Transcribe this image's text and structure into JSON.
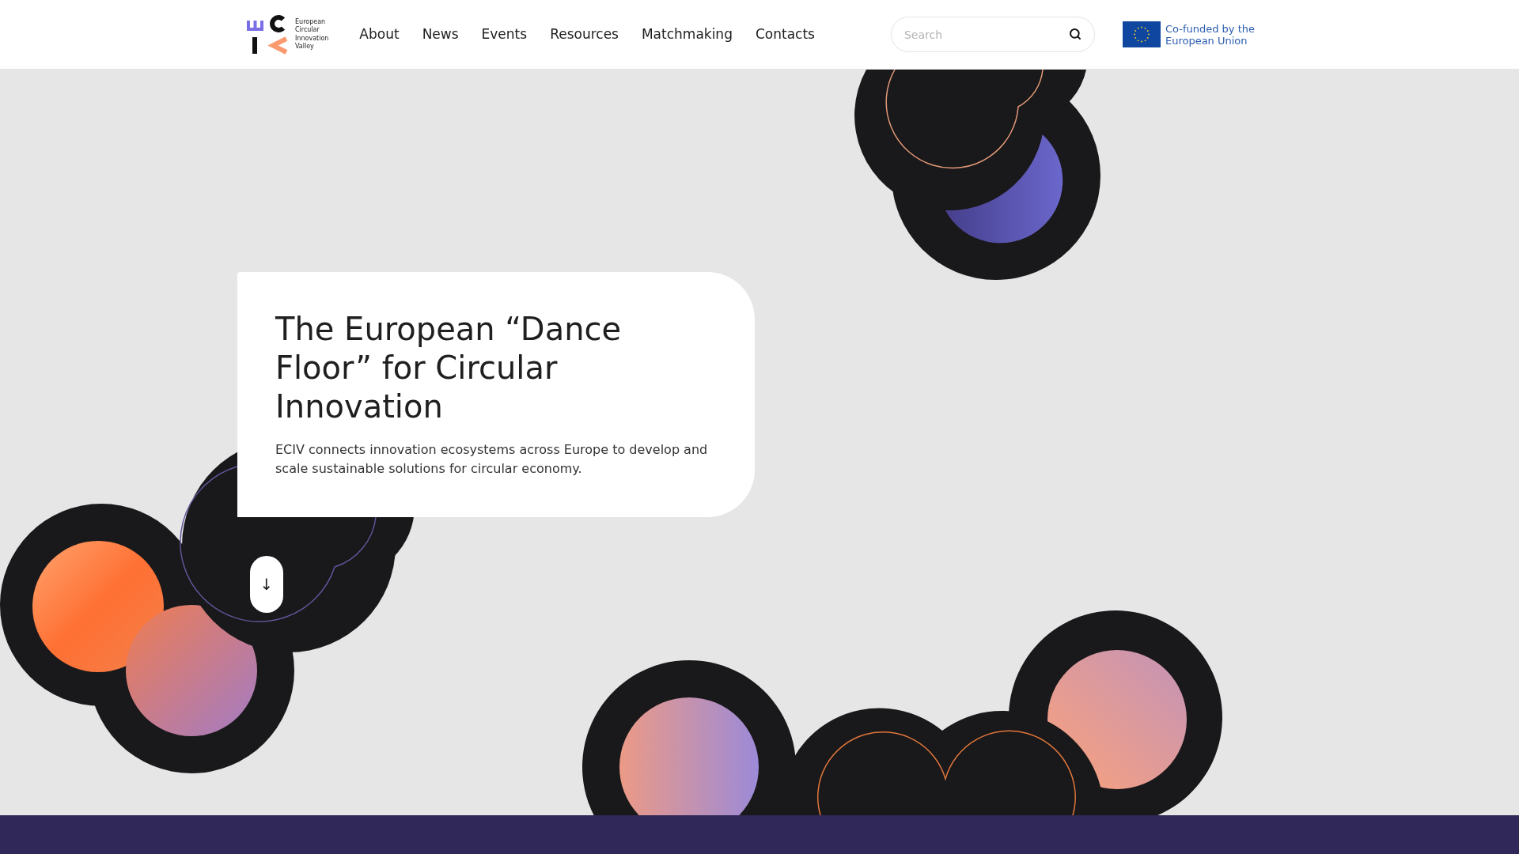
{
  "header": {
    "logo": {
      "lines": [
        "European",
        "Circular",
        "Innovation",
        "Valley"
      ]
    },
    "nav": [
      {
        "label": "About"
      },
      {
        "label": "News"
      },
      {
        "label": "Events"
      },
      {
        "label": "Resources"
      },
      {
        "label": "Matchmaking"
      },
      {
        "label": "Contacts"
      }
    ],
    "search": {
      "placeholder": "Search"
    },
    "funding": {
      "lines": [
        "Co-funded by the",
        "European Union"
      ]
    }
  },
  "hero": {
    "title": "The European “Dance Floor” for Circular Innovation",
    "description": "ECIV connects innovation ecosystems across Europe to develop and scale sustainable solutions for circular economy.",
    "scroll_button": {
      "label": "↓"
    }
  }
}
